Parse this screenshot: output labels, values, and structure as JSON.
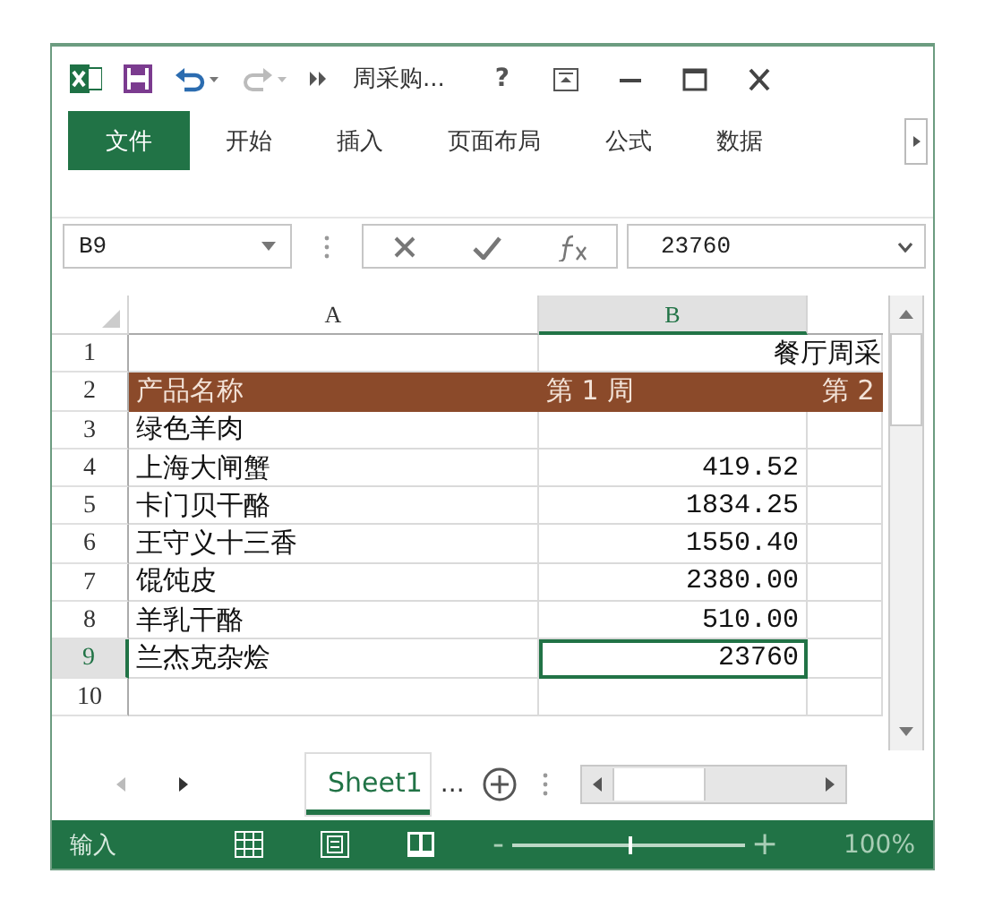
{
  "title_bar": {
    "title": "周采购...",
    "help": "?"
  },
  "ribbon_tabs": [
    {
      "label": "文件",
      "kind": "file"
    },
    {
      "label": "开始",
      "kind": "tab"
    },
    {
      "label": "插入",
      "kind": "tab"
    },
    {
      "label": "页面布局",
      "kind": "tab"
    },
    {
      "label": "公式",
      "kind": "tab"
    },
    {
      "label": "数据",
      "kind": "tab"
    }
  ],
  "formula_bar": {
    "name_box": "B9",
    "value": "23760"
  },
  "columns": [
    {
      "label": "A",
      "selected": false
    },
    {
      "label": "B",
      "selected": true
    }
  ],
  "rows": [
    {
      "number": "1",
      "kind": "title",
      "selected": false,
      "cells": [
        "餐厅周采"
      ]
    },
    {
      "number": "2",
      "kind": "header",
      "selected": false,
      "cells": [
        "产品名称",
        "第 1 周",
        "第 2"
      ]
    },
    {
      "number": "3",
      "kind": "data",
      "selected": false,
      "cells": [
        "绿色羊肉"
      ]
    },
    {
      "number": "4",
      "kind": "data",
      "selected": false,
      "cells": [
        "上海大闸蟹",
        "419.52"
      ]
    },
    {
      "number": "5",
      "kind": "data",
      "selected": false,
      "cells": [
        "卡门贝干酪",
        "1834.25"
      ]
    },
    {
      "number": "6",
      "kind": "data",
      "selected": false,
      "cells": [
        "王守义十三香",
        "1550.40"
      ]
    },
    {
      "number": "7",
      "kind": "data",
      "selected": false,
      "cells": [
        "馄饨皮",
        "2380.00"
      ]
    },
    {
      "number": "8",
      "kind": "data",
      "selected": false,
      "cells": [
        "羊乳干酪",
        "510.00"
      ]
    },
    {
      "number": "9",
      "kind": "data",
      "selected": true,
      "cells": [
        "兰杰克杂烩",
        "23760"
      ]
    },
    {
      "number": "10",
      "kind": "data",
      "selected": false,
      "cells": []
    }
  ],
  "sheet_tabs": [
    {
      "label": "Sheet1",
      "selected": true
    }
  ],
  "sheet_more": "...",
  "status_bar": {
    "mode": "输入",
    "zoom": {
      "out": "-",
      "level": 0.5,
      "in": "+",
      "reading": "100%"
    }
  }
}
